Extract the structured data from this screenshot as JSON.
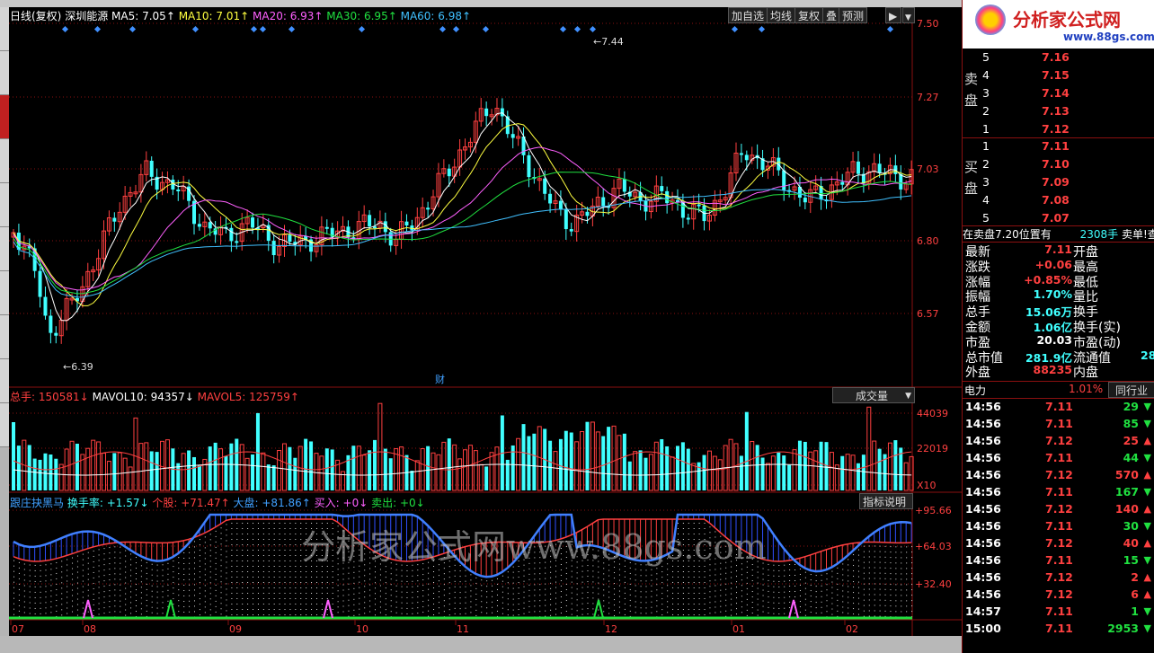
{
  "colors": {
    "up": "#ff4040",
    "down": "#40ffff",
    "ma5": "#ffffff",
    "ma10": "#ffff40",
    "ma20": "#ff60ff",
    "ma30": "#20e040",
    "ma60": "#40c0ff",
    "grid": "#8a1010"
  },
  "kline": {
    "period_label": "日线(复权)",
    "stock_name": "深圳能源",
    "ma5": "MA5: 7.05↑",
    "ma10": "MA10: 7.01↑",
    "ma20": "MA20: 6.93↑",
    "ma30": "MA30: 6.95↑",
    "ma60": "MA60: 6.98↑",
    "buttons": [
      "加自选",
      "均线",
      "复权",
      "叠",
      "预测"
    ],
    "y_ticks": [
      "7.50",
      "7.27",
      "7.03",
      "6.80",
      "6.57"
    ],
    "high_label": "7.44",
    "low_label": "6.39",
    "fin_marker": "财"
  },
  "volume": {
    "label_total": "总手: 150581↓",
    "label_mavol10": "MAVOL10: 94357↓",
    "label_mavol5": "MAVOL5: 125759↑",
    "selector": "成交量",
    "y_ticks": [
      "44039",
      "22019",
      "X10"
    ]
  },
  "indicator": {
    "name": "跟庄抉黑马",
    "turnover": "换手率: +1.57↓",
    "stock": "个股: +71.47↑",
    "market": "大盘: +81.86↑",
    "buy": "买入: +0↓",
    "sell": "卖出: +0↓",
    "explain_button": "指标说明",
    "y_ticks": [
      "+95.66",
      "+64.03",
      "+32.40"
    ],
    "watermark": "分析家公式网www.88gs.com"
  },
  "x_axis": [
    "07",
    "08",
    "09",
    "10",
    "11",
    "12",
    "01",
    "02"
  ],
  "logo": {
    "title": "分析家公式网",
    "url": "www.88gs.com"
  },
  "order_book": {
    "sell_label": "卖盘",
    "sell": [
      {
        "lvl": "5",
        "price": "7.16"
      },
      {
        "lvl": "4",
        "price": "7.15"
      },
      {
        "lvl": "3",
        "price": "7.14"
      },
      {
        "lvl": "2",
        "price": "7.13"
      },
      {
        "lvl": "1",
        "price": "7.12"
      }
    ],
    "buy_label": "买盘",
    "buy": [
      {
        "lvl": "1",
        "price": "7.11"
      },
      {
        "lvl": "2",
        "price": "7.10"
      },
      {
        "lvl": "3",
        "price": "7.09"
      },
      {
        "lvl": "4",
        "price": "7.08"
      },
      {
        "lvl": "5",
        "price": "7.07"
      }
    ],
    "notice_left": "在卖盘7.20位置有",
    "notice_vol": "2308手",
    "notice_right": "卖单!查"
  },
  "quote": [
    {
      "k": "最新",
      "v": "7.11",
      "vc": "red",
      "k2": "开盘"
    },
    {
      "k": "涨跌",
      "v": "+0.06",
      "vc": "red",
      "k2": "最高"
    },
    {
      "k": "涨幅",
      "v": "+0.85%",
      "vc": "red",
      "k2": "最低"
    },
    {
      "k": "振幅",
      "v": "1.70%",
      "vc": "cyan",
      "k2": "量比"
    },
    {
      "k": "总手",
      "v": "15.06万",
      "vc": "cyan",
      "k2": "换手"
    },
    {
      "k": "金额",
      "v": "1.06亿",
      "vc": "cyan",
      "k2": "换手(实)"
    },
    {
      "k": "市盈",
      "v": "20.03",
      "vc": "white",
      "k2": "市盈(动)"
    },
    {
      "k": "总市值",
      "v": "281.9亿",
      "vc": "cyan",
      "k2": "流通值",
      "v2": "28"
    },
    {
      "k": "外盘",
      "v": "88235",
      "vc": "red",
      "k2": "内盘"
    }
  ],
  "sector": {
    "name": "电力",
    "change": "1.01%",
    "tab": "同行业"
  },
  "ticks": [
    {
      "t": "14:56",
      "p": "7.11",
      "v": "29",
      "d": "down"
    },
    {
      "t": "14:56",
      "p": "7.11",
      "v": "85",
      "d": "down"
    },
    {
      "t": "14:56",
      "p": "7.12",
      "v": "25",
      "d": "up"
    },
    {
      "t": "14:56",
      "p": "7.11",
      "v": "44",
      "d": "down"
    },
    {
      "t": "14:56",
      "p": "7.12",
      "v": "570",
      "d": "up"
    },
    {
      "t": "14:56",
      "p": "7.11",
      "v": "167",
      "d": "down"
    },
    {
      "t": "14:56",
      "p": "7.12",
      "v": "140",
      "d": "up"
    },
    {
      "t": "14:56",
      "p": "7.11",
      "v": "30",
      "d": "down"
    },
    {
      "t": "14:56",
      "p": "7.12",
      "v": "40",
      "d": "up"
    },
    {
      "t": "14:56",
      "p": "7.11",
      "v": "15",
      "d": "down"
    },
    {
      "t": "14:56",
      "p": "7.12",
      "v": "2",
      "d": "up"
    },
    {
      "t": "14:56",
      "p": "7.12",
      "v": "6",
      "d": "up"
    },
    {
      "t": "14:57",
      "p": "7.11",
      "v": "1",
      "d": "down"
    },
    {
      "t": "15:00",
      "p": "7.11",
      "v": "2953",
      "d": "down"
    }
  ]
}
